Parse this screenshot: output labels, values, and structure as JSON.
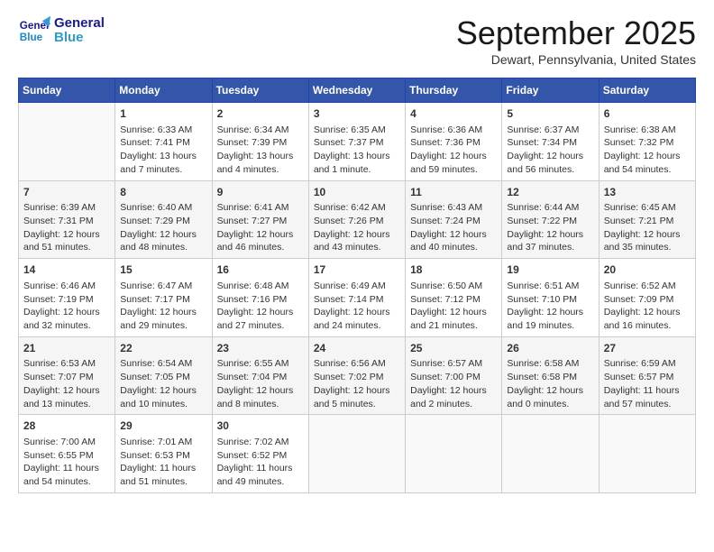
{
  "header": {
    "logo_line1": "General",
    "logo_line2": "Blue",
    "month": "September 2025",
    "location": "Dewart, Pennsylvania, United States"
  },
  "weekdays": [
    "Sunday",
    "Monday",
    "Tuesday",
    "Wednesday",
    "Thursday",
    "Friday",
    "Saturday"
  ],
  "weeks": [
    [
      {
        "num": "",
        "info": ""
      },
      {
        "num": "1",
        "info": "Sunrise: 6:33 AM\nSunset: 7:41 PM\nDaylight: 13 hours\nand 7 minutes."
      },
      {
        "num": "2",
        "info": "Sunrise: 6:34 AM\nSunset: 7:39 PM\nDaylight: 13 hours\nand 4 minutes."
      },
      {
        "num": "3",
        "info": "Sunrise: 6:35 AM\nSunset: 7:37 PM\nDaylight: 13 hours\nand 1 minute."
      },
      {
        "num": "4",
        "info": "Sunrise: 6:36 AM\nSunset: 7:36 PM\nDaylight: 12 hours\nand 59 minutes."
      },
      {
        "num": "5",
        "info": "Sunrise: 6:37 AM\nSunset: 7:34 PM\nDaylight: 12 hours\nand 56 minutes."
      },
      {
        "num": "6",
        "info": "Sunrise: 6:38 AM\nSunset: 7:32 PM\nDaylight: 12 hours\nand 54 minutes."
      }
    ],
    [
      {
        "num": "7",
        "info": "Sunrise: 6:39 AM\nSunset: 7:31 PM\nDaylight: 12 hours\nand 51 minutes."
      },
      {
        "num": "8",
        "info": "Sunrise: 6:40 AM\nSunset: 7:29 PM\nDaylight: 12 hours\nand 48 minutes."
      },
      {
        "num": "9",
        "info": "Sunrise: 6:41 AM\nSunset: 7:27 PM\nDaylight: 12 hours\nand 46 minutes."
      },
      {
        "num": "10",
        "info": "Sunrise: 6:42 AM\nSunset: 7:26 PM\nDaylight: 12 hours\nand 43 minutes."
      },
      {
        "num": "11",
        "info": "Sunrise: 6:43 AM\nSunset: 7:24 PM\nDaylight: 12 hours\nand 40 minutes."
      },
      {
        "num": "12",
        "info": "Sunrise: 6:44 AM\nSunset: 7:22 PM\nDaylight: 12 hours\nand 37 minutes."
      },
      {
        "num": "13",
        "info": "Sunrise: 6:45 AM\nSunset: 7:21 PM\nDaylight: 12 hours\nand 35 minutes."
      }
    ],
    [
      {
        "num": "14",
        "info": "Sunrise: 6:46 AM\nSunset: 7:19 PM\nDaylight: 12 hours\nand 32 minutes."
      },
      {
        "num": "15",
        "info": "Sunrise: 6:47 AM\nSunset: 7:17 PM\nDaylight: 12 hours\nand 29 minutes."
      },
      {
        "num": "16",
        "info": "Sunrise: 6:48 AM\nSunset: 7:16 PM\nDaylight: 12 hours\nand 27 minutes."
      },
      {
        "num": "17",
        "info": "Sunrise: 6:49 AM\nSunset: 7:14 PM\nDaylight: 12 hours\nand 24 minutes."
      },
      {
        "num": "18",
        "info": "Sunrise: 6:50 AM\nSunset: 7:12 PM\nDaylight: 12 hours\nand 21 minutes."
      },
      {
        "num": "19",
        "info": "Sunrise: 6:51 AM\nSunset: 7:10 PM\nDaylight: 12 hours\nand 19 minutes."
      },
      {
        "num": "20",
        "info": "Sunrise: 6:52 AM\nSunset: 7:09 PM\nDaylight: 12 hours\nand 16 minutes."
      }
    ],
    [
      {
        "num": "21",
        "info": "Sunrise: 6:53 AM\nSunset: 7:07 PM\nDaylight: 12 hours\nand 13 minutes."
      },
      {
        "num": "22",
        "info": "Sunrise: 6:54 AM\nSunset: 7:05 PM\nDaylight: 12 hours\nand 10 minutes."
      },
      {
        "num": "23",
        "info": "Sunrise: 6:55 AM\nSunset: 7:04 PM\nDaylight: 12 hours\nand 8 minutes."
      },
      {
        "num": "24",
        "info": "Sunrise: 6:56 AM\nSunset: 7:02 PM\nDaylight: 12 hours\nand 5 minutes."
      },
      {
        "num": "25",
        "info": "Sunrise: 6:57 AM\nSunset: 7:00 PM\nDaylight: 12 hours\nand 2 minutes."
      },
      {
        "num": "26",
        "info": "Sunrise: 6:58 AM\nSunset: 6:58 PM\nDaylight: 12 hours\nand 0 minutes."
      },
      {
        "num": "27",
        "info": "Sunrise: 6:59 AM\nSunset: 6:57 PM\nDaylight: 11 hours\nand 57 minutes."
      }
    ],
    [
      {
        "num": "28",
        "info": "Sunrise: 7:00 AM\nSunset: 6:55 PM\nDaylight: 11 hours\nand 54 minutes."
      },
      {
        "num": "29",
        "info": "Sunrise: 7:01 AM\nSunset: 6:53 PM\nDaylight: 11 hours\nand 51 minutes."
      },
      {
        "num": "30",
        "info": "Sunrise: 7:02 AM\nSunset: 6:52 PM\nDaylight: 11 hours\nand 49 minutes."
      },
      {
        "num": "",
        "info": ""
      },
      {
        "num": "",
        "info": ""
      },
      {
        "num": "",
        "info": ""
      },
      {
        "num": "",
        "info": ""
      }
    ]
  ]
}
